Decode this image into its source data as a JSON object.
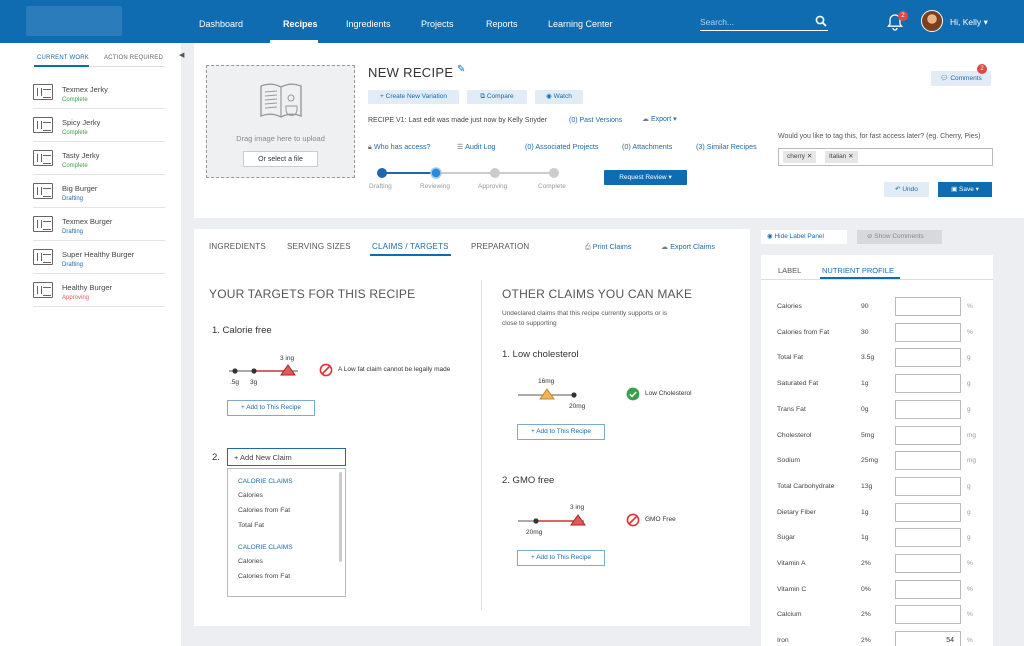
{
  "nav": {
    "items": [
      "Dashboard",
      "Recipes",
      "Ingredients",
      "Projects",
      "Reports",
      "Learning Center"
    ],
    "active": "Recipes",
    "search_placeholder": "Search...",
    "notification_count": "2",
    "user_greeting": "Hi, Kelly"
  },
  "sidebar": {
    "tabs": [
      "CURRENT WORK",
      "ACTION REQUIRED"
    ],
    "items": [
      {
        "name": "Texmex Jerky",
        "status": "Complete",
        "color": "#3aa045"
      },
      {
        "name": "Spicy Jerky",
        "status": "Complete",
        "color": "#3aa045"
      },
      {
        "name": "Tasty Jerky",
        "status": "Complete",
        "color": "#3aa045"
      },
      {
        "name": "Big Burger",
        "status": "Drafting",
        "color": "#1d69ab"
      },
      {
        "name": "Texmex Burger",
        "status": "Drafting",
        "color": "#1d69ab"
      },
      {
        "name": "Super Healthy Burger",
        "status": "Drafting",
        "color": "#1d69ab"
      },
      {
        "name": "Healthy Burger",
        "status": "Approving",
        "color": "#e05a5a"
      }
    ]
  },
  "header": {
    "drop_text": "Drag image here to upload",
    "drop_button": "Or select a file",
    "title": "NEW RECIPE",
    "buttons": {
      "create_variation": "+ Create New Variation",
      "compare": "Compare",
      "watch": "Watch"
    },
    "version_text": "RECIPE  V1: Last edit was made just now by Kelly Snyder",
    "past_versions": "(0) Past Versions",
    "export": "Export",
    "tools": {
      "who_access": "Who has access?",
      "audit_log": "Audit Log",
      "associated": "(0) Associated Projects",
      "attachments": "(0) Attachments",
      "similar": "(3) Similar Recipes"
    },
    "steps": [
      "Drafting",
      "Reviewing",
      "Approving",
      "Complete"
    ],
    "request_review": "Request Review",
    "comments": "Comments",
    "comments_count": "2",
    "tag_question": "Would you like to tag this, for fast access later? (eg. Cherry, Pies)",
    "tags": [
      "cherry",
      "Italian"
    ],
    "undo": "Undo",
    "save": "Save"
  },
  "claims": {
    "tabs": [
      "INGREDIENTS",
      "SERVING SIZES",
      "CLAIMS / TARGETS",
      "PREPARATION"
    ],
    "active_tab": "CLAIMS / TARGETS",
    "print": "Print Claims",
    "export": "Export Claims",
    "left_heading": "YOUR TARGETS FOR THIS RECIPE",
    "right_heading": "OTHER CLAIMS YOU CAN MAKE",
    "right_sub_1": "Undeclared claims that this recipe currently supports or is",
    "right_sub_2": "close to supporting",
    "target1": {
      "title": "1. Calorie free",
      "marker": "3 ing",
      "tick1": ".5g",
      "tick2": "3g",
      "warning": "A Low fat claim cannot be legally made"
    },
    "add_button": "+ Add to This Recipe",
    "target2_num": "2.",
    "new_claim": "+ Add New Claim",
    "dropdown": {
      "groups": [
        {
          "header": "CALORIE CLAIMS",
          "items": [
            "Calories",
            "Calories from Fat",
            "Total Fat"
          ]
        },
        {
          "header": "CALORIE CLAIMS",
          "items": [
            "Calories",
            "Calories from Fat"
          ]
        }
      ]
    },
    "other1": {
      "title": "1. Low cholesterol",
      "marker": "16mg",
      "tick": "20mg",
      "result": "Low Cholesterol"
    },
    "other2": {
      "title": "2. GMO free",
      "marker": "3 ing",
      "tick": "20mg",
      "result": "GMO Free"
    }
  },
  "label_panel": {
    "hide": "Hide Label Panel",
    "show_comments": "Show Comments",
    "tabs": [
      "LABEL",
      "NUTRIENT PROFILE"
    ],
    "active_tab": "NUTRIENT PROFILE",
    "nutrients": [
      {
        "name": "Calories",
        "value": "90",
        "unit": "%",
        "input": ""
      },
      {
        "name": "Calories from Fat",
        "value": "30",
        "unit": "%",
        "input": ""
      },
      {
        "name": "Total Fat",
        "value": "3.5g",
        "unit": "g",
        "input": ""
      },
      {
        "name": "Saturated Fat",
        "value": "1g",
        "unit": "g",
        "input": ""
      },
      {
        "name": "Trans Fat",
        "value": "0g",
        "unit": "g",
        "input": ""
      },
      {
        "name": "Cholesterol",
        "value": "5mg",
        "unit": "mg",
        "input": ""
      },
      {
        "name": "Sodium",
        "value": "25mg",
        "unit": "mg",
        "input": ""
      },
      {
        "name": "Total Carbohydrate",
        "value": "13g",
        "unit": "g",
        "input": ""
      },
      {
        "name": "Dietary Fiber",
        "value": "1g",
        "unit": "g",
        "input": ""
      },
      {
        "name": "Sugar",
        "value": "1g",
        "unit": "g",
        "input": ""
      },
      {
        "name": "Vitamin A",
        "value": "2%",
        "unit": "%",
        "input": ""
      },
      {
        "name": "Vitamin C",
        "value": "0%",
        "unit": "%",
        "input": ""
      },
      {
        "name": "Calcium",
        "value": "2%",
        "unit": "%",
        "input": ""
      },
      {
        "name": "Iron",
        "value": "2%",
        "unit": "%",
        "input": "54"
      }
    ]
  }
}
